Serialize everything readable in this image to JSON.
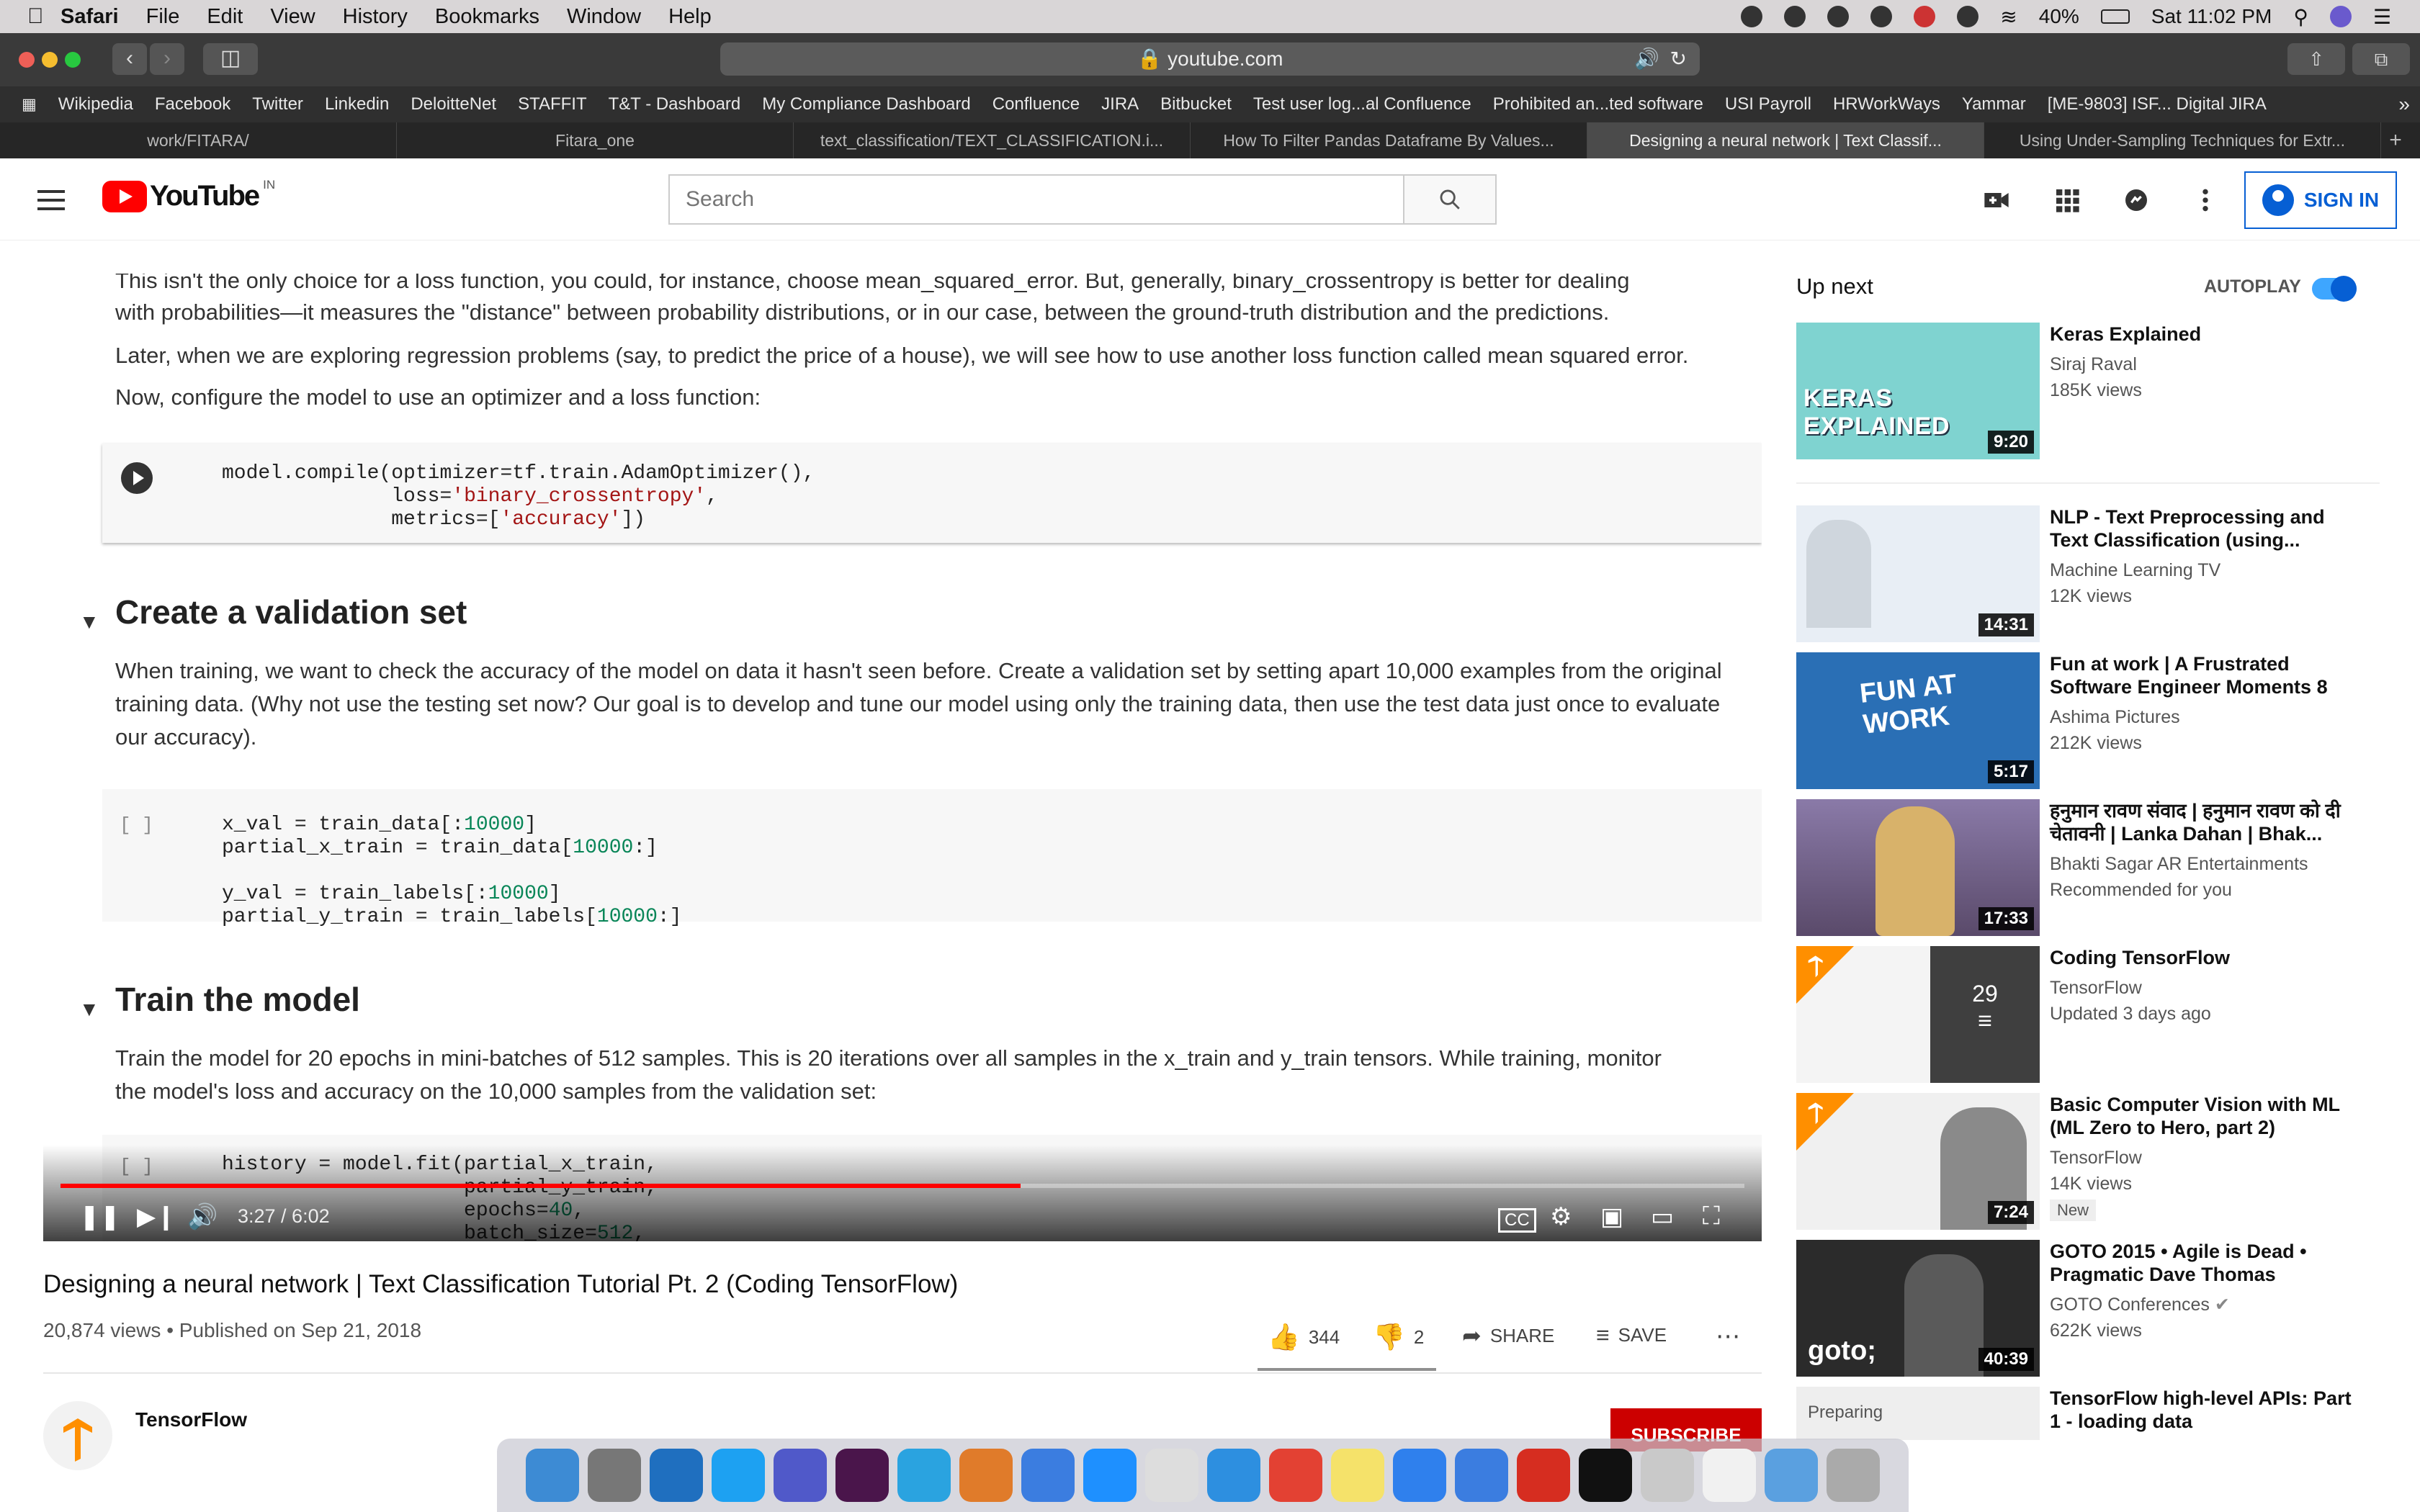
{
  "menubar": {
    "app": "Safari",
    "items": [
      "File",
      "Edit",
      "View",
      "History",
      "Bookmarks",
      "Window",
      "Help"
    ],
    "battery": "40%",
    "clock": "Sat 11:02 PM"
  },
  "browser": {
    "url": "youtube.com",
    "favorites": [
      "Wikipedia",
      "Facebook",
      "Twitter",
      "Linkedin",
      "DeloitteNet",
      "STAFFIT",
      "T&T - Dashboard",
      "My Compliance Dashboard",
      "Confluence",
      "JIRA",
      "Bitbucket",
      "Test user log...al Confluence",
      "Prohibited an...ted software",
      "USI Payroll",
      "HRWorkWays",
      "Yammar",
      "[ME-9803] ISF... Digital JIRA"
    ],
    "tabs": [
      "work/FITARA/",
      "Fitara_one",
      "text_classification/TEXT_CLASSIFICATION.i...",
      "How To Filter Pandas Dataframe By Values...",
      "Designing a neural network | Text Classif...",
      "Using Under-Sampling Techniques for Extr..."
    ]
  },
  "youtube": {
    "logo": "YouTube",
    "region": "IN",
    "search_placeholder": "Search",
    "signin": "SIGN IN"
  },
  "doc": {
    "p0a": "This isn't the only choice for a loss function, you could, for instance, choose mean_squared_error. But, generally, binary_crossentropy is better for dealing",
    "p0b": "with probabilities—it measures the \"distance\" between probability distributions, or in our case, between the ground-truth distribution and the predictions.",
    "p1": "Later, when we are exploring regression problems (say, to predict the price of a house), we will see how to use another loss function called mean squared error.",
    "p2": "Now, configure the model to use an optimizer and a loss function:",
    "h_validation": "Create a validation set",
    "p3a": "When training, we want to check the accuracy of the model on data it hasn't seen before. Create a validation set by setting apart 10,000 examples from the original",
    "p3b": "training data. (Why not use the testing set now? Our goal is to develop and tune our model using only the training data, then use the test data just once to evaluate",
    "p3c": "our accuracy).",
    "h_train": "Train the model",
    "p4a": "Train the model for 20 epochs in mini-batches of 512 samples. This is 20 iterations over all samples in the x_train and y_train tensors. While training, monitor",
    "p4b": "the model's loss and accuracy on the 10,000 samples from the validation set:",
    "cell_bracket": "[ ]"
  },
  "player": {
    "time": "3:27 / 6:02",
    "progress": 0.57
  },
  "video": {
    "title": "Designing a neural network | Text Classification Tutorial Pt. 2 (Coding TensorFlow)",
    "meta": "20,874 views • Published on Sep 21, 2018",
    "likes": "344",
    "dislikes": "2",
    "share": "SHARE",
    "save": "SAVE",
    "channel": "TensorFlow",
    "subscribe": "SUBSCRIBE"
  },
  "sidebar": {
    "upnext": "Up next",
    "autoplay": "AUTOPLAY",
    "videos": [
      {
        "title": "Keras Explained",
        "channel": "Siraj Raval",
        "views": "185K views",
        "duration": "9:20",
        "thumb": "#7fd3d0"
      },
      {
        "title": "NLP - Text Preprocessing and Text Classification (using...",
        "channel": "Machine Learning TV",
        "views": "12K views",
        "duration": "14:31",
        "thumb": "#e8eef5"
      },
      {
        "title": "Fun at work | A Frustrated Software Engineer Moments 8",
        "channel": "Ashima Pictures",
        "views": "212K views",
        "duration": "5:17",
        "thumb": "#2a6fb5"
      },
      {
        "title": "हनुमान रावण संवाद | हनुमान रावण को दी चेतावनी | Lanka Dahan | Bhak...",
        "channel": "Bhakti Sagar AR Entertainments",
        "views": "Recommended for you",
        "duration": "17:33",
        "thumb": "#6b5a8a"
      },
      {
        "title": "Coding TensorFlow",
        "channel": "TensorFlow",
        "views": "Updated 3 days ago",
        "duration": "29",
        "thumb": "#f4f4f4"
      },
      {
        "title": "Basic Computer Vision with ML (ML Zero to Hero, part 2)",
        "channel": "TensorFlow",
        "views": "14K views",
        "duration": "7:24",
        "badge": "New",
        "thumb": "#f0f0f0"
      },
      {
        "title": "GOTO 2015 • Agile is Dead • Pragmatic Dave Thomas",
        "channel": "GOTO Conferences",
        "views": "622K views",
        "duration": "40:39",
        "thumb": "#2b2b2b"
      },
      {
        "title": "TensorFlow high-level APIs: Part 1 - loading data",
        "channel": "",
        "views": "",
        "duration": "",
        "thumb": "#eee"
      }
    ]
  }
}
